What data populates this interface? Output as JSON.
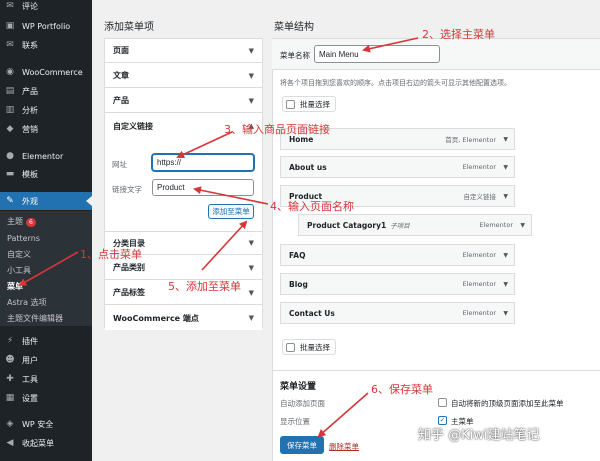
{
  "sidebar": {
    "items": [
      {
        "label": "评论",
        "icon": "comment-icon"
      },
      {
        "label": "WP Portfolio",
        "icon": "portfolio-icon"
      },
      {
        "label": "联系",
        "icon": "mail-icon"
      },
      {
        "label": "WooCommerce",
        "icon": "woo-icon"
      },
      {
        "label": "产品",
        "icon": "product-icon"
      },
      {
        "label": "分析",
        "icon": "chart-icon"
      },
      {
        "label": "营销",
        "icon": "megaphone-icon"
      },
      {
        "label": "Elementor",
        "icon": "elementor-icon"
      },
      {
        "label": "模板",
        "icon": "folder-icon"
      },
      {
        "label": "外观",
        "icon": "brush-icon"
      },
      {
        "label": "插件",
        "icon": "plugin-icon"
      },
      {
        "label": "用户",
        "icon": "user-icon"
      },
      {
        "label": "工具",
        "icon": "wrench-icon"
      },
      {
        "label": "设置",
        "icon": "settings-icon"
      },
      {
        "label": "WP 安全",
        "icon": "shield-icon"
      },
      {
        "label": "收起菜单",
        "icon": "collapse-icon"
      }
    ],
    "submenu": [
      {
        "label": "主题",
        "badge": "6"
      },
      {
        "label": "Patterns"
      },
      {
        "label": "自定义"
      },
      {
        "label": "小工具"
      },
      {
        "label": "菜单"
      },
      {
        "label": "Astra 选项"
      },
      {
        "label": "主题文件编辑器"
      }
    ]
  },
  "left_panel": {
    "title": "添加菜单项",
    "sections": [
      "页面",
      "文章",
      "产品"
    ],
    "custom_link": {
      "title": "自定义链接",
      "url_label": "网址",
      "url_value": "https://",
      "text_label": "链接文字",
      "text_value": "Product",
      "add_button": "添加至菜单"
    },
    "more_sections": [
      "分类目录",
      "产品类别",
      "产品标签",
      "WooCommerce 端点"
    ]
  },
  "right_panel": {
    "title": "菜单结构",
    "menu_name_label": "菜单名称",
    "menu_name_value": "Main Menu",
    "hint": "将各个项目拖到您喜欢的顺序。点击项目右边的箭头可显示其他配置选项。",
    "bulk_select": "批量选择",
    "items": [
      {
        "title": "Home",
        "meta": "首页, Elementor"
      },
      {
        "title": "About us",
        "meta": "Elementor"
      },
      {
        "title": "Product",
        "meta": "自定义链接"
      },
      {
        "title": "Product Catagory1",
        "subtag": "子项目",
        "meta": "Elementor"
      },
      {
        "title": "FAQ",
        "meta": "Elementor"
      },
      {
        "title": "Blog",
        "meta": "Elementor"
      },
      {
        "title": "Contact Us",
        "meta": "Elementor"
      }
    ],
    "settings": {
      "title": "菜单设置",
      "auto_add_label": "自动添加页面",
      "auto_add_text": "自动将新的顶级页面添加至此菜单",
      "display_label": "显示位置",
      "primary_menu": "主菜单"
    },
    "save_button": "保存菜单",
    "delete_link": "删除菜单"
  },
  "annotations": [
    "1、点击菜单",
    "2、选择主菜单",
    "3、输入商品页面链接",
    "4、输入页面名称",
    "5、添加至菜单",
    "6、保存菜单"
  ],
  "watermark": "知乎 @Kiwi建站笔记",
  "colors": {
    "sidebar_bg": "#1d2327",
    "accent": "#2271b1",
    "annotation": "#d63638",
    "delete": "#b32d2e"
  }
}
